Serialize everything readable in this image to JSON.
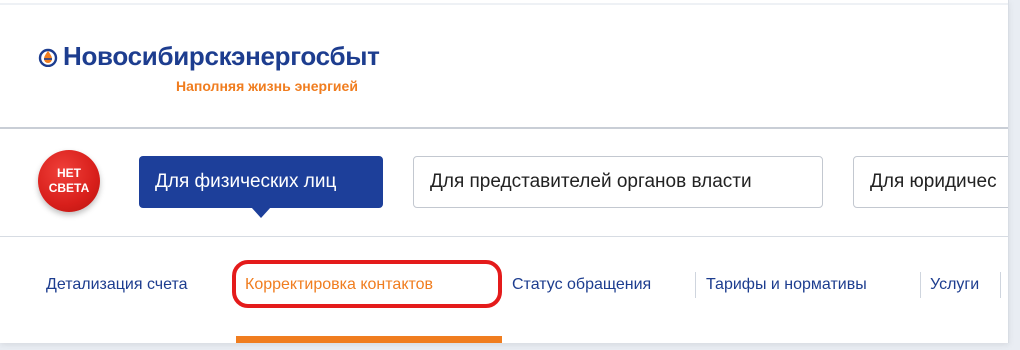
{
  "brand": {
    "title": "Новосибирскэнергосбыт",
    "tagline": "Наполняя жизнь энергией",
    "logo_icon": "flame-drop-icon",
    "colors": {
      "primary": "#1d3f9a",
      "accent": "#f07d1f",
      "alert": "#d81f1b"
    }
  },
  "alert_button": {
    "line1": "НЕТ",
    "line2": "СВЕТА"
  },
  "audience_tabs": [
    {
      "label": "Для физических лиц",
      "active": true
    },
    {
      "label": "Для представителей органов власти",
      "active": false
    },
    {
      "label": "Для юридичес",
      "active": false
    }
  ],
  "subnav": [
    {
      "label": "Детализация счета",
      "active": false
    },
    {
      "label": "Корректировка контактов",
      "active": true
    },
    {
      "label": "Статус обращения",
      "active": false
    },
    {
      "label": "Тарифы и нормативы",
      "active": false
    },
    {
      "label": "Услуги",
      "active": false
    }
  ]
}
